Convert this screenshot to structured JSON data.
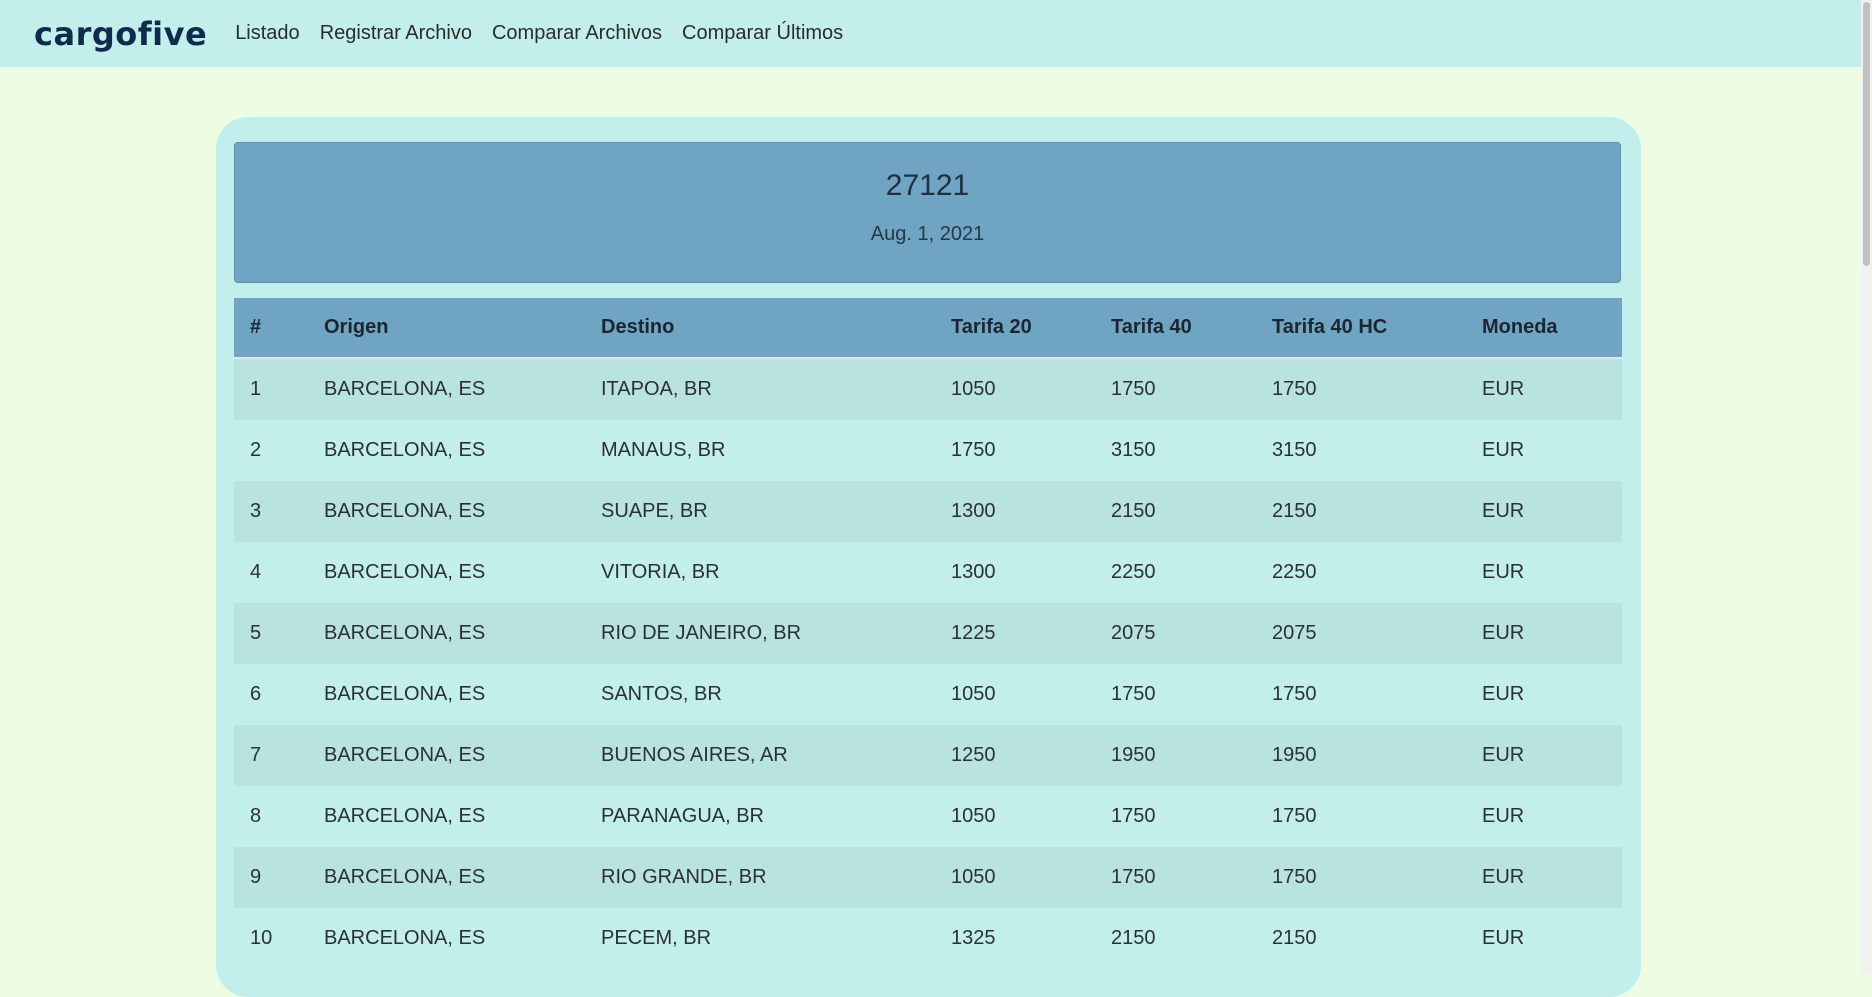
{
  "navbar": {
    "brand": "cargofive",
    "links": [
      "Listado",
      "Registrar Archivo",
      "Comparar Archivos",
      "Comparar Últimos"
    ]
  },
  "file": {
    "id": "27121",
    "date": "Aug. 1, 2021"
  },
  "table": {
    "headers": [
      "#",
      "Origen",
      "Destino",
      "Tarifa 20",
      "Tarifa 40",
      "Tarifa 40 HC",
      "Moneda"
    ],
    "rows": [
      [
        "1",
        "BARCELONA, ES",
        "ITAPOA, BR",
        "1050",
        "1750",
        "1750",
        "EUR"
      ],
      [
        "2",
        "BARCELONA, ES",
        "MANAUS, BR",
        "1750",
        "3150",
        "3150",
        "EUR"
      ],
      [
        "3",
        "BARCELONA, ES",
        "SUAPE, BR",
        "1300",
        "2150",
        "2150",
        "EUR"
      ],
      [
        "4",
        "BARCELONA, ES",
        "VITORIA, BR",
        "1300",
        "2250",
        "2250",
        "EUR"
      ],
      [
        "5",
        "BARCELONA, ES",
        "RIO DE JANEIRO, BR",
        "1225",
        "2075",
        "2075",
        "EUR"
      ],
      [
        "6",
        "BARCELONA, ES",
        "SANTOS, BR",
        "1050",
        "1750",
        "1750",
        "EUR"
      ],
      [
        "7",
        "BARCELONA, ES",
        "BUENOS AIRES, AR",
        "1250",
        "1950",
        "1950",
        "EUR"
      ],
      [
        "8",
        "BARCELONA, ES",
        "PARANAGUA, BR",
        "1050",
        "1750",
        "1750",
        "EUR"
      ],
      [
        "9",
        "BARCELONA, ES",
        "RIO GRANDE, BR",
        "1050",
        "1750",
        "1750",
        "EUR"
      ],
      [
        "10",
        "BARCELONA, ES",
        "PECEM, BR",
        "1325",
        "2150",
        "2150",
        "EUR"
      ]
    ]
  },
  "colors": {
    "page_background": "#ecfde4",
    "navbar_background": "#c2efec",
    "header_blue": "#6fa5c2",
    "row_stripe": "#b8e3e1"
  }
}
